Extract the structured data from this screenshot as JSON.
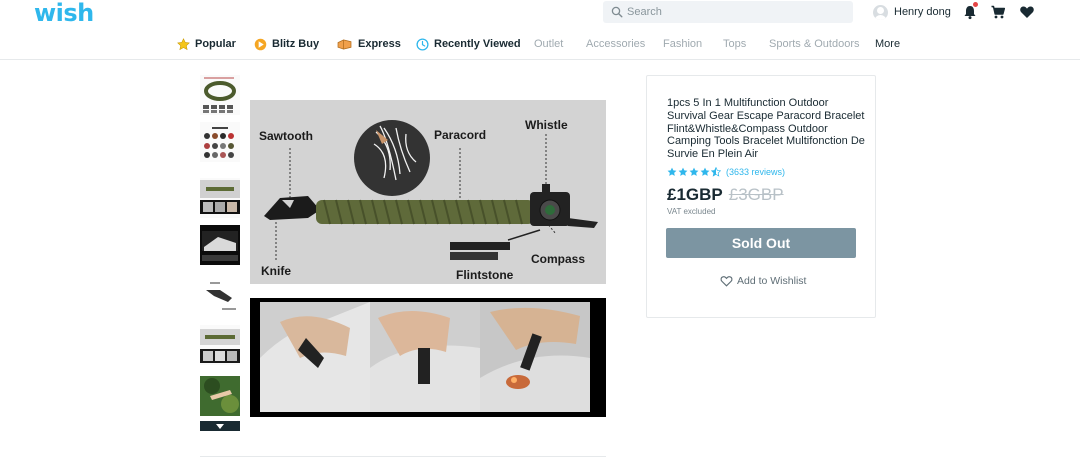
{
  "header": {
    "logo": "wish",
    "search_placeholder": "Search",
    "user_name": "Henry dong"
  },
  "nav": [
    {
      "label": "Popular",
      "icon": "star-icon"
    },
    {
      "label": "Blitz Buy",
      "icon": "blitz-buy-icon"
    },
    {
      "label": "Express",
      "icon": "express-icon"
    },
    {
      "label": "Recently Viewed",
      "icon": "clock-icon"
    },
    {
      "label": "Outlet"
    },
    {
      "label": "Accessories"
    },
    {
      "label": "Fashion"
    },
    {
      "label": "Tops"
    },
    {
      "label": "Sports & Outdoors"
    },
    {
      "label": "More"
    }
  ],
  "product": {
    "title": "1pcs 5 In 1 Multifunction Outdoor Survival Gear Escape Paracord Bracelet Flint&Whistle&Compass Outdoor Camping Tools Bracelet Multifonction De Survie En Plein Air",
    "rating": 4.5,
    "reviews": "(3633 reviews)",
    "price": "£1GBP",
    "old_price": "£3GBP",
    "vat_note": "VAT excluded",
    "sold_out_label": "Sold Out",
    "wishlist_label": "Add to Wishlist"
  },
  "main_image_labels": {
    "sawtooth": "Sawtooth",
    "paracord": "Paracord",
    "whistle": "Whistle",
    "knife": "Knife",
    "flintstone": "Flintstone",
    "compass": "Compass"
  },
  "colors": {
    "brand": "#2fb7ec",
    "sold_out": "#7c95a2",
    "star": "#2fb7ec",
    "text": "#192a32",
    "muted": "#a0aab0"
  }
}
